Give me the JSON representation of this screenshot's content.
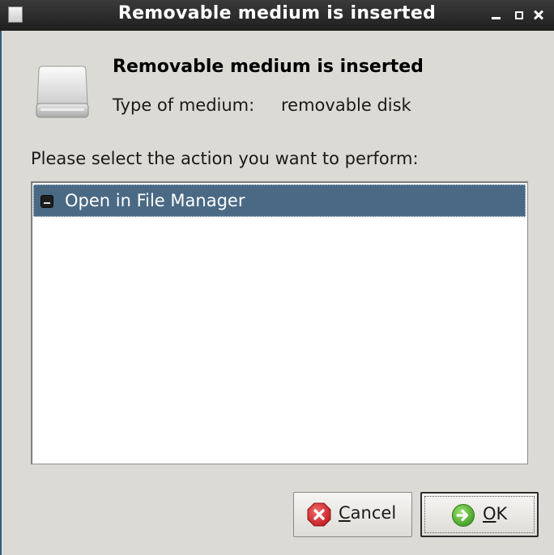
{
  "window": {
    "title": "Removable medium is inserted"
  },
  "content": {
    "heading": "Removable medium is inserted",
    "type_label": "Type of medium:",
    "type_value": "removable disk",
    "prompt": "Please select the action you want to perform:"
  },
  "actions": {
    "items": [
      {
        "label": "Open in File Manager",
        "selected": true,
        "icon": "drive-icon"
      }
    ]
  },
  "buttons": {
    "cancel": {
      "accel": "C",
      "rest": "ancel",
      "icon": "cancel-icon"
    },
    "ok": {
      "accel": "O",
      "rest": "K",
      "icon": "ok-icon"
    }
  },
  "colors": {
    "titlebar": "#2a2a2a",
    "window_bg": "#dcdad5",
    "selection": "#4a6984",
    "cancel_red": "#d8262b",
    "ok_green": "#4cae2f"
  }
}
